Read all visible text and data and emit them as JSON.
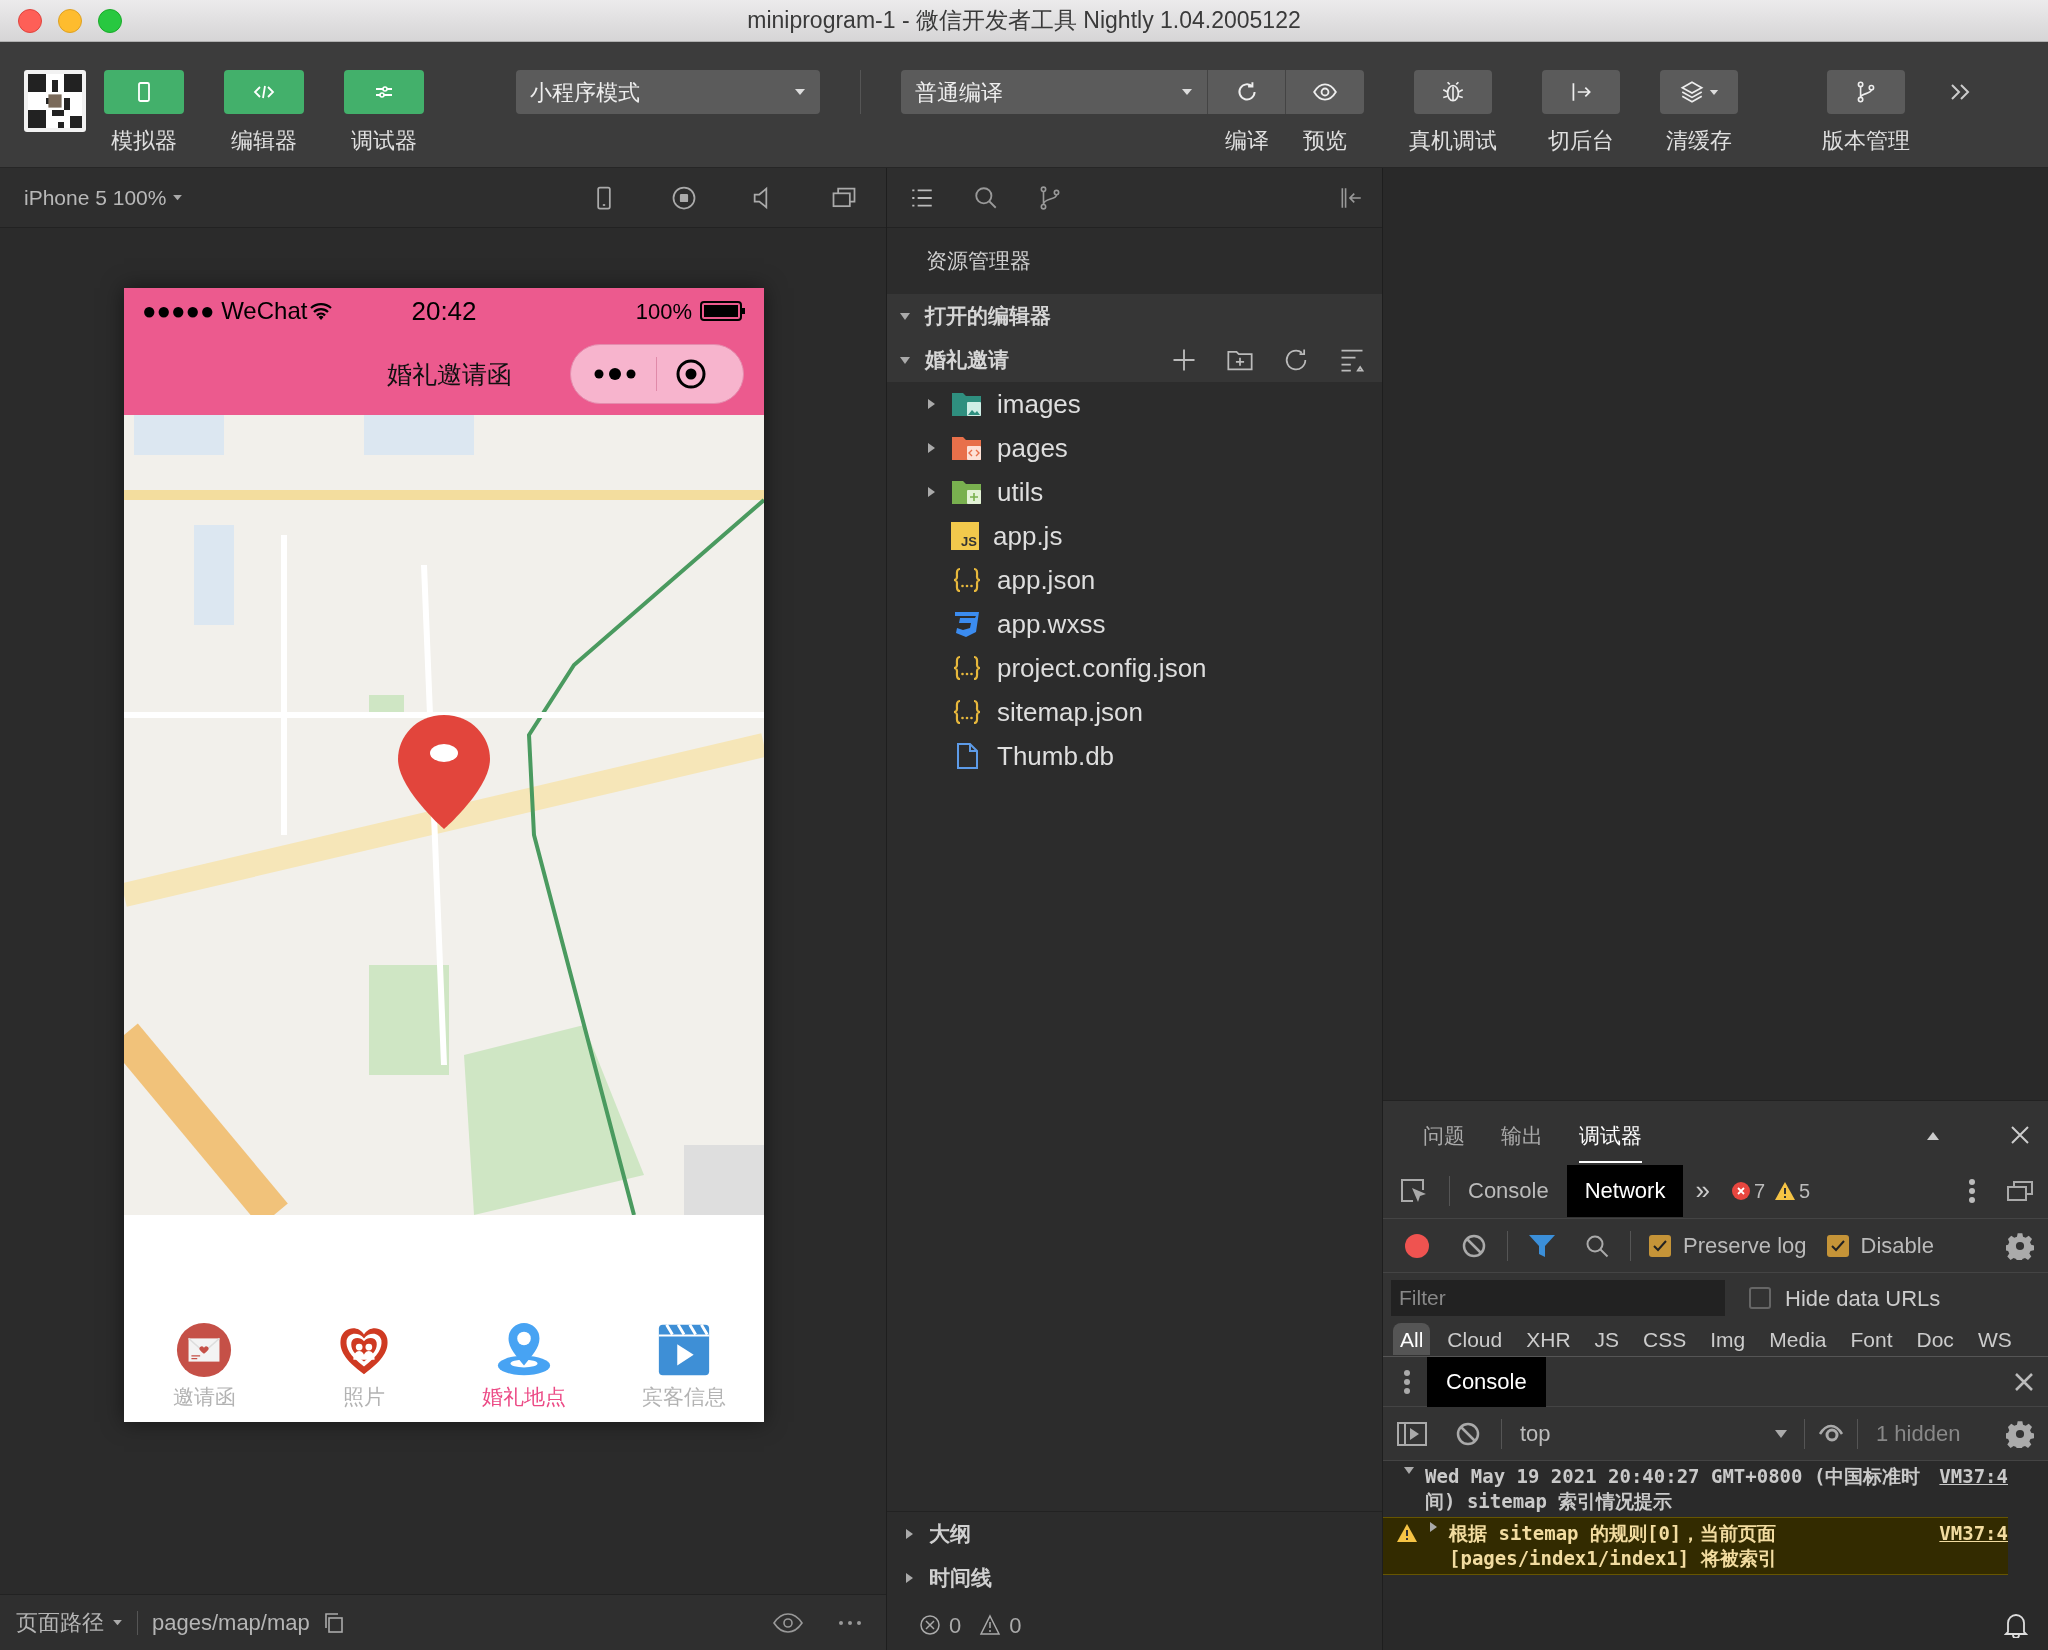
{
  "window": {
    "title": "miniprogram-1 - 微信开发者工具 Nightly 1.04.2005122"
  },
  "toolbar": {
    "panel_buttons": [
      {
        "label": "模拟器",
        "selected": true
      },
      {
        "label": "编辑器",
        "selected": true
      },
      {
        "label": "调试器",
        "selected": true
      }
    ],
    "mode_select": "小程序模式",
    "compile_select": "普通编译",
    "compile_actions": [
      {
        "label": "编译"
      },
      {
        "label": "预览"
      }
    ],
    "actions": [
      {
        "label": "真机调试"
      },
      {
        "label": "切后台"
      },
      {
        "label": "清缓存"
      },
      {
        "label": "版本管理"
      }
    ]
  },
  "simulator": {
    "device": "iPhone 5 100%",
    "phone": {
      "status_bar": {
        "carrier": "●●●●● WeChat",
        "time": "20:42",
        "battery": "100%"
      },
      "nav_title": "婚礼邀请函",
      "tab_bar": [
        {
          "label": "邀请函",
          "selected": false
        },
        {
          "label": "照片",
          "selected": false
        },
        {
          "label": "婚礼地点",
          "selected": true
        },
        {
          "label": "宾客信息",
          "selected": false
        }
      ]
    },
    "page_path_label": "页面路径",
    "page_path": "pages/map/map"
  },
  "explorer": {
    "title": "资源管理器",
    "sections": [
      {
        "label": "打开的编辑器",
        "expanded": true
      },
      {
        "label": "婚礼邀请",
        "expanded": true
      }
    ],
    "tree": [
      {
        "name": "images",
        "kind": "images_folder",
        "expanded": false
      },
      {
        "name": "pages",
        "kind": "pages_folder",
        "expanded": false
      },
      {
        "name": "utils",
        "kind": "utils_folder",
        "expanded": false
      },
      {
        "name": "app.js",
        "kind": "js",
        "icon_text": "JS"
      },
      {
        "name": "app.json",
        "kind": "json"
      },
      {
        "name": "app.wxss",
        "kind": "wxss"
      },
      {
        "name": "project.config.json",
        "kind": "json"
      },
      {
        "name": "sitemap.json",
        "kind": "json"
      },
      {
        "name": "Thumb.db",
        "kind": "file"
      }
    ],
    "bottom_sections": [
      {
        "label": "大纲",
        "expanded": false
      },
      {
        "label": "时间线",
        "expanded": false
      }
    ],
    "errors": "0",
    "warnings": "0"
  },
  "devtools": {
    "panel_tabs": [
      {
        "label": "问题",
        "selected": false
      },
      {
        "label": "输出",
        "selected": false
      },
      {
        "label": "调试器",
        "selected": true
      }
    ],
    "tabs": [
      {
        "label": "Console",
        "selected": false
      },
      {
        "label": "Network",
        "selected": true
      }
    ],
    "more_tabs": "»",
    "error_count": "7",
    "warning_count": "5",
    "preserve_log": {
      "label": "Preserve log",
      "checked": true
    },
    "disable_cache": {
      "label": "Disable",
      "checked": true
    },
    "filter": {
      "placeholder": "Filter"
    },
    "hide_data_urls": {
      "label": "Hide data URLs",
      "checked": false
    },
    "types": [
      {
        "label": "All",
        "selected": true
      },
      {
        "label": "Cloud",
        "selected": false
      },
      {
        "label": "XHR",
        "selected": false
      },
      {
        "label": "JS",
        "selected": false
      },
      {
        "label": "CSS",
        "selected": false
      },
      {
        "label": "Img",
        "selected": false
      },
      {
        "label": "Media",
        "selected": false
      },
      {
        "label": "Font",
        "selected": false
      },
      {
        "label": "Doc",
        "selected": false
      },
      {
        "label": "WS",
        "selected": false
      }
    ],
    "drawer_tab": "Console",
    "context": "top",
    "hidden": "1 hidden",
    "messages": [
      {
        "kind": "info",
        "text": "Wed May 19 2021 20:40:27 GMT+0800 (中国标准时间) sitemap 索引情况提示",
        "source": "VM37:4"
      },
      {
        "kind": "warning",
        "text": "根据 sitemap 的规则[0]，当前页面 [pages/index1/index1] 将被索引",
        "source": "VM37:4"
      }
    ]
  }
}
